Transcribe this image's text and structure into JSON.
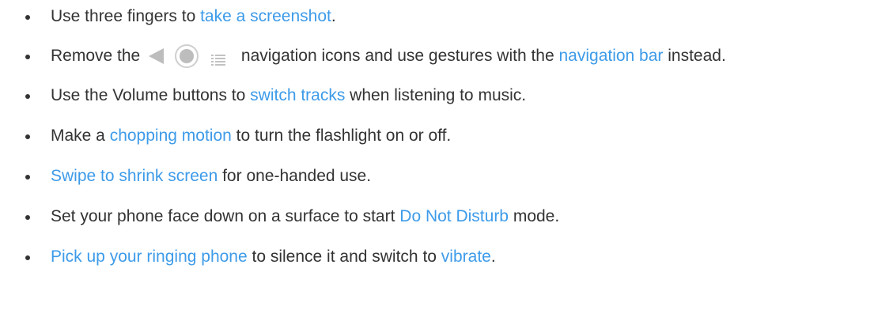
{
  "items": [
    {
      "before": "Use three fingers to ",
      "link": "take a screenshot",
      "after": "."
    },
    {
      "before": "Remove the ",
      "icons": [
        "back-triangle-icon",
        "home-circle-icon",
        "recents-lines-icon"
      ],
      "middle": " navigation icons and use gestures with the ",
      "link": "navigation bar",
      "after": " instead."
    },
    {
      "before": "Use the Volume buttons to ",
      "link": "switch tracks",
      "after": " when listening to music."
    },
    {
      "before": "Make a ",
      "link": "chopping motion",
      "after": " to turn the flashlight on or off."
    },
    {
      "before": "",
      "link": "Swipe to shrink screen",
      "after": " for one-handed use."
    },
    {
      "before": "Set your phone face down on a surface to start ",
      "link": "Do Not Disturb",
      "after": " mode."
    },
    {
      "before": "",
      "link": "Pick up your ringing phone",
      "after": " to silence it and switch to ",
      "link2": "vibrate",
      "after2": "."
    }
  ],
  "colors": {
    "text": "#333333",
    "link": "#3d9be9",
    "icon": "#bdbdbd"
  }
}
